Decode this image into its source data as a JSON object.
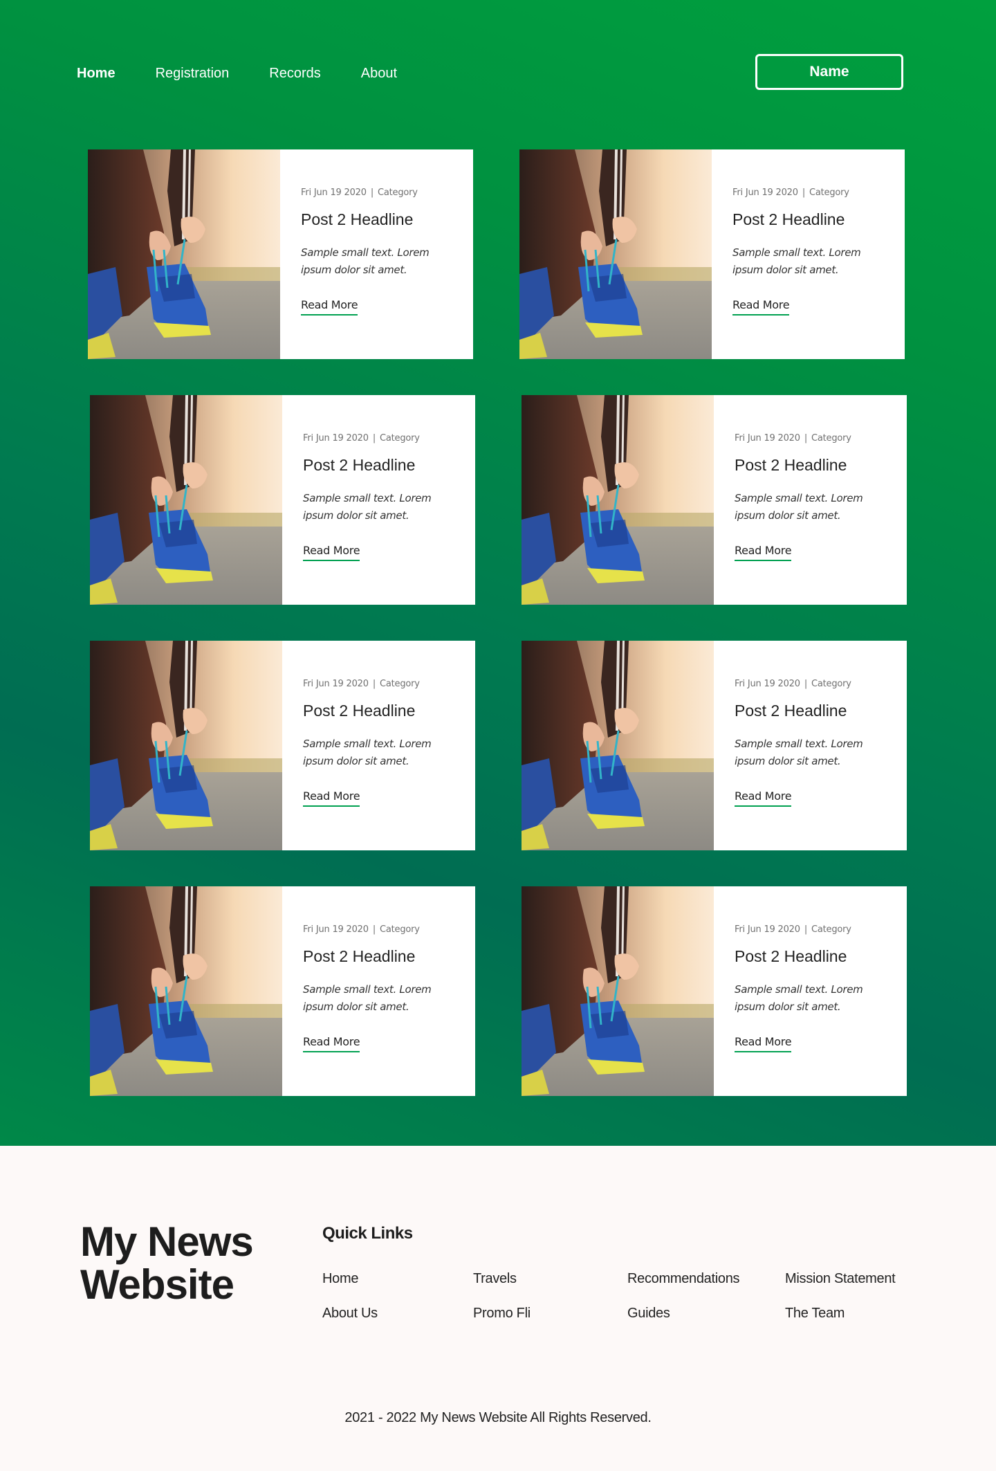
{
  "nav": {
    "items": [
      {
        "label": "Home",
        "active": true
      },
      {
        "label": "Registration",
        "active": false
      },
      {
        "label": "Records",
        "active": false
      },
      {
        "label": "About",
        "active": false
      }
    ],
    "name_button": "Name"
  },
  "posts": [
    {
      "date": "Fri Jun 19 2020",
      "category": "Category",
      "headline": "Post 2 Headline",
      "excerpt": "Sample small text. Lorem ipsum dolor sit amet.",
      "read_more": "Read More"
    },
    {
      "date": "Fri Jun 19 2020",
      "category": "Category",
      "headline": "Post 2 Headline",
      "excerpt": "Sample small text. Lorem ipsum dolor sit amet.",
      "read_more": "Read More"
    },
    {
      "date": "Fri Jun 19 2020",
      "category": "Category",
      "headline": "Post 2 Headline",
      "excerpt": "Sample small text. Lorem ipsum dolor sit amet.",
      "read_more": "Read More"
    },
    {
      "date": "Fri Jun 19 2020",
      "category": "Category",
      "headline": "Post 2 Headline",
      "excerpt": "Sample small text. Lorem ipsum dolor sit amet.",
      "read_more": "Read More"
    },
    {
      "date": "Fri Jun 19 2020",
      "category": "Category",
      "headline": "Post 2 Headline",
      "excerpt": "Sample small text. Lorem ipsum dolor sit amet.",
      "read_more": "Read More"
    },
    {
      "date": "Fri Jun 19 2020",
      "category": "Category",
      "headline": "Post 2 Headline",
      "excerpt": "Sample small text. Lorem ipsum dolor sit amet.",
      "read_more": "Read More"
    },
    {
      "date": "Fri Jun 19 2020",
      "category": "Category",
      "headline": "Post 2 Headline",
      "excerpt": "Sample small text. Lorem ipsum dolor sit amet.",
      "read_more": "Read More"
    },
    {
      "date": "Fri Jun 19 2020",
      "category": "Category",
      "headline": "Post 2 Headline",
      "excerpt": "Sample small text. Lorem ipsum dolor sit amet.",
      "read_more": "Read More"
    }
  ],
  "footer": {
    "brand": "My News Website",
    "quick_links_title": "Quick Links",
    "links": [
      "Home",
      "Travels",
      "Recommendations",
      "Mission Statement",
      "About Us",
      "Promo Fli",
      "Guides",
      "The Team"
    ],
    "copyright": "2021 - 2022 My News Website All Rights Reserved."
  },
  "colors": {
    "accent_green": "#009a40",
    "underline_green": "#00a050"
  }
}
